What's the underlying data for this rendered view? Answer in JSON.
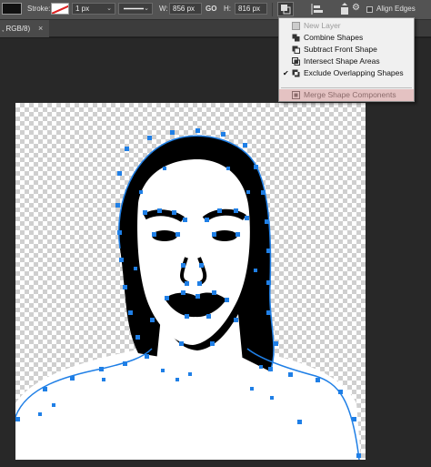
{
  "options_bar": {
    "stroke_label": "Stroke:",
    "stroke_width": "1 px",
    "w_label": "W:",
    "w_value": "856 px",
    "link_label": "GO",
    "h_label": "H:",
    "h_value": "816 px",
    "align_edges_label": "Align Edges"
  },
  "document_tab": {
    "label": ", RGB/8)",
    "close": "×"
  },
  "path_operations_menu": {
    "items": [
      {
        "label": "New Layer",
        "state": "disabled"
      },
      {
        "label": "Combine Shapes",
        "state": "normal"
      },
      {
        "label": "Subtract Front Shape",
        "state": "normal"
      },
      {
        "label": "Intersect Shape Areas",
        "state": "normal"
      },
      {
        "label": "Exclude Overlapping Shapes",
        "state": "checked"
      },
      {
        "label": "Merge Shape Components",
        "state": "highlighted"
      }
    ],
    "check_mark": "✔"
  },
  "colors": {
    "path_anchor": "#1f7fe6",
    "fill": "#000000",
    "menu_highlight": "#e4c2c2"
  },
  "icons": [
    "path-operations-icon",
    "path-alignment-icon",
    "path-arrangement-icon",
    "gear-icon"
  ]
}
